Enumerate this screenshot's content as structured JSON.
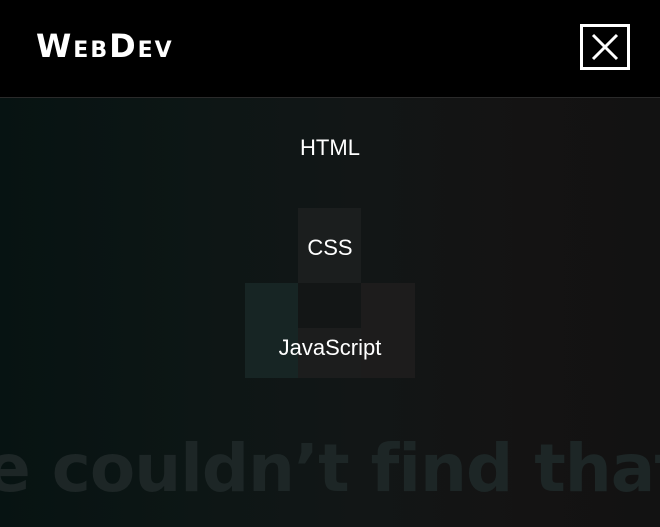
{
  "header": {
    "logo_text": "WebDev",
    "close_icon": "close-icon"
  },
  "menu": {
    "items": [
      {
        "label": "HTML"
      },
      {
        "label": "CSS"
      },
      {
        "label": "JavaScript"
      }
    ]
  },
  "background": {
    "headline": "e couldn’t find that pho"
  },
  "colors": {
    "header_bg": "#000000",
    "text": "#ffffff",
    "overlay_bg": "#0d1615"
  }
}
